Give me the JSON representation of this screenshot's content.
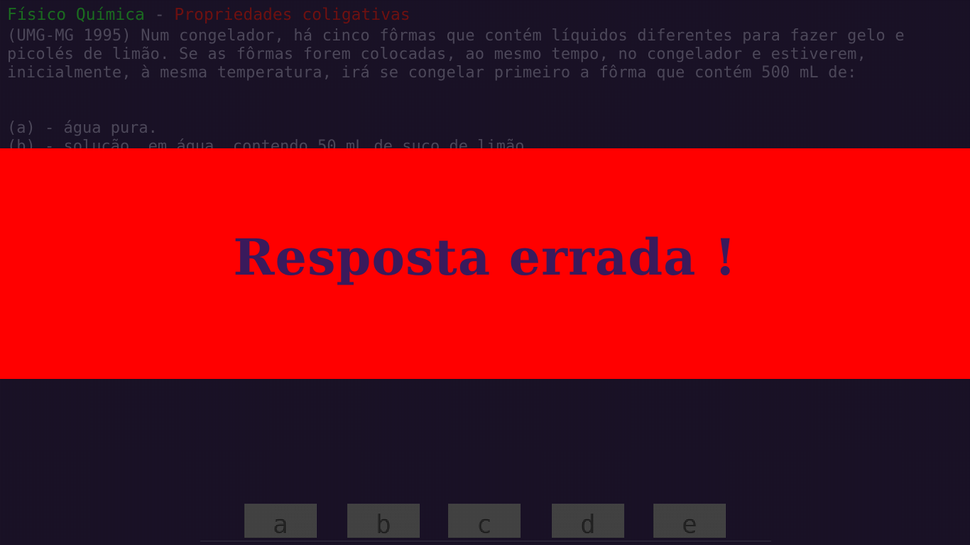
{
  "header": {
    "subject": "Físico Química",
    "separator": " - ",
    "topic": "Propriedades coligativas"
  },
  "question": {
    "text": "(UMG-MG 1995) Num congelador, há cinco fôrmas que contém líquidos diferentes para fazer gelo e picolés de limão. Se as fôrmas forem colocadas, ao mesmo tempo, no congelador e estiverem, inicialmente, à mesma temperatura, irá se congelar primeiro a fôrma que contém 500 mL de:"
  },
  "options": [
    {
      "text": "(a) - água pura."
    },
    {
      "text": "(b) - solução, em água, contendo 50 mL de suco de limão."
    }
  ],
  "banner": {
    "message": "Resposta errada !",
    "color": "#ff0000",
    "text_color": "#3a1a5c"
  },
  "answer_buttons": [
    {
      "label": "a"
    },
    {
      "label": "b"
    },
    {
      "label": "c"
    },
    {
      "label": "d"
    },
    {
      "label": "e"
    }
  ]
}
